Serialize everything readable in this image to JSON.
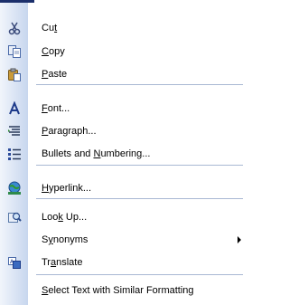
{
  "menu": {
    "items": [
      {
        "id": "cut",
        "pre": "Cu",
        "key": "t",
        "post": "",
        "icon": "scissors-icon"
      },
      {
        "id": "copy",
        "pre": "",
        "key": "C",
        "post": "opy",
        "icon": "copy-icon"
      },
      {
        "id": "paste",
        "pre": "",
        "key": "P",
        "post": "aste",
        "icon": "paste-icon"
      },
      {
        "id": "font",
        "pre": "",
        "key": "F",
        "post": "ont...",
        "icon": "font-icon"
      },
      {
        "id": "paragraph",
        "pre": "",
        "key": "P",
        "post": "aragraph...",
        "icon": "paragraph-icon"
      },
      {
        "id": "bullets",
        "pre": "Bullets and ",
        "key": "N",
        "post": "umbering...",
        "icon": "bullets-icon"
      },
      {
        "id": "hyperlink",
        "pre": "",
        "key": "H",
        "post": "yperlink...",
        "icon": "hyperlink-icon"
      },
      {
        "id": "lookup",
        "pre": "Loo",
        "key": "k",
        "post": " Up...",
        "icon": "lookup-icon"
      },
      {
        "id": "synonyms",
        "pre": "S",
        "key": "y",
        "post": "nonyms",
        "icon": "",
        "submenu": true
      },
      {
        "id": "translate",
        "pre": "Tr",
        "key": "a",
        "post": "nslate",
        "icon": "translate-icon"
      },
      {
        "id": "select-similar",
        "pre": "",
        "key": "S",
        "post": "elect Text with Similar Formatting",
        "icon": ""
      }
    ]
  }
}
